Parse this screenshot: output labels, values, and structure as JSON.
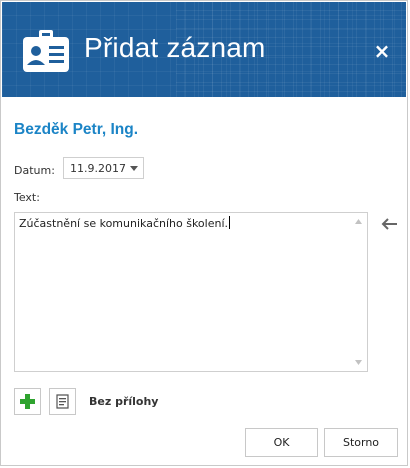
{
  "dialog": {
    "title": "Přidat záznam",
    "close_label": "×",
    "header_icon": "id-card-icon",
    "colors": {
      "header_bg": "#1f5f9c",
      "name_color": "#1b84c6",
      "add_icon": "#2fa32f"
    }
  },
  "person": {
    "name": "Bezděk Petr, Ing."
  },
  "form": {
    "date_label": "Datum:",
    "date_value": "11.9.2017",
    "text_label": "Text:",
    "text_value": "Zúčastnění se komunikačního školení."
  },
  "attachments": {
    "add_icon": "plus-icon",
    "attach_icon": "document-icon",
    "status": "Bez přílohy"
  },
  "buttons": {
    "ok": "OK",
    "cancel": "Storno"
  }
}
